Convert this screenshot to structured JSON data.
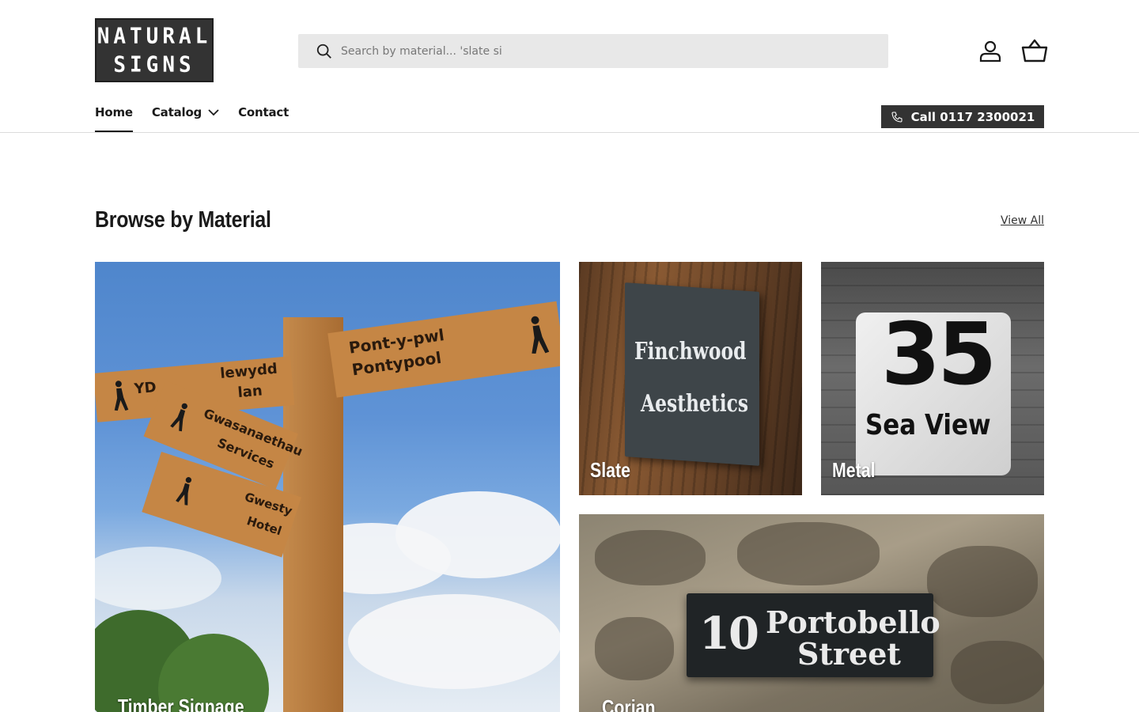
{
  "brand": {
    "logo_line1": "NATURAL",
    "logo_line2": "SIGNS"
  },
  "search": {
    "placeholder": "Search by material... 'slate si"
  },
  "header_icons": {
    "account": "account-icon",
    "cart": "basket-icon"
  },
  "nav": {
    "items": [
      {
        "label": "Home",
        "active": true
      },
      {
        "label": "Catalog",
        "has_dropdown": true
      },
      {
        "label": "Contact"
      }
    ]
  },
  "call": {
    "label": "Call 0117 2300021",
    "icon": "phone-icon"
  },
  "section": {
    "title": "Browse by Material",
    "view_all": "View All"
  },
  "tiles": [
    {
      "label": "Timber Signage",
      "image": {
        "sign_arm_1_lines": [
          "Pont-y-pwl",
          "Pontypool"
        ],
        "sign_arm_2_lines": [
          "YD",
          "lewydd",
          "lan"
        ],
        "sign_arm_3_lines": [
          "Gwasanaethau",
          "Services"
        ],
        "sign_arm_4_lines": [
          "Gwesty",
          "Hotel"
        ]
      }
    },
    {
      "label": "Slate",
      "image": {
        "lines": [
          "Finchwood",
          "Aesthetics"
        ]
      }
    },
    {
      "label": "Metal",
      "image": {
        "number": "35",
        "text": "Sea View"
      }
    },
    {
      "label": "Corian",
      "image": {
        "number": "10",
        "lines": [
          "Portobello",
          "Street"
        ]
      }
    }
  ],
  "colors": {
    "accent_dark": "#333333",
    "search_bg": "#e8e8e8",
    "text": "#1a1a1a"
  }
}
